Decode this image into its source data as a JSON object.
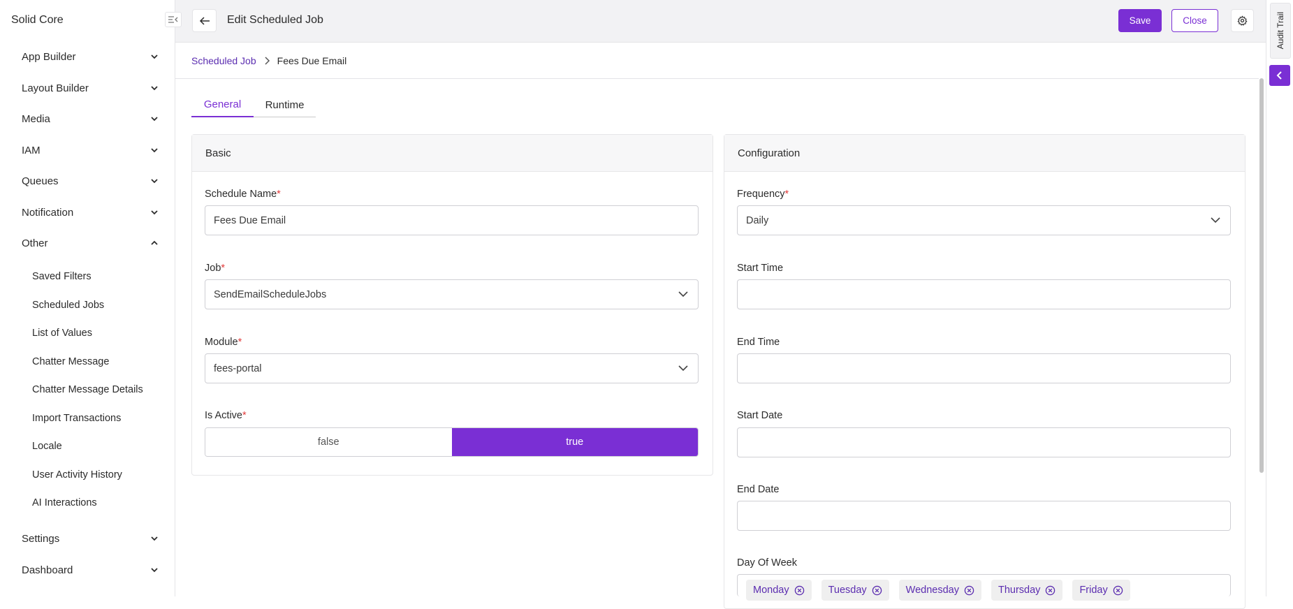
{
  "sidebar": {
    "brand": "Solid Core",
    "groups": [
      {
        "label": "App Builder",
        "expanded": false
      },
      {
        "label": "Layout Builder",
        "expanded": false
      },
      {
        "label": "Media",
        "expanded": false
      },
      {
        "label": "IAM",
        "expanded": false
      },
      {
        "label": "Queues",
        "expanded": false
      },
      {
        "label": "Notification",
        "expanded": false
      },
      {
        "label": "Other",
        "expanded": true
      },
      {
        "label": "Settings",
        "expanded": false
      },
      {
        "label": "Dashboard",
        "expanded": false
      }
    ],
    "other_items": [
      "Saved Filters",
      "Scheduled Jobs",
      "List of Values",
      "Chatter Message",
      "Chatter Message Details",
      "Import Transactions",
      "Locale",
      "User Activity History",
      "AI Interactions"
    ]
  },
  "header": {
    "title": "Edit Scheduled Job",
    "save_label": "Save",
    "close_label": "Close"
  },
  "right_rail": {
    "audit_label": "Audit Trail"
  },
  "breadcrumb": {
    "parent": "Scheduled Job",
    "current": "Fees Due Email"
  },
  "tabs": [
    {
      "label": "General",
      "active": true
    },
    {
      "label": "Runtime",
      "active": false
    }
  ],
  "basic": {
    "title": "Basic",
    "schedule_name": {
      "label": "Schedule Name",
      "value": "Fees Due Email"
    },
    "job": {
      "label": "Job",
      "value": "SendEmailScheduleJobs"
    },
    "module": {
      "label": "Module",
      "value": "fees-portal"
    },
    "is_active": {
      "label": "Is Active",
      "options": [
        "false",
        "true"
      ],
      "selected": "true"
    }
  },
  "configuration": {
    "title": "Configuration",
    "frequency": {
      "label": "Frequency",
      "value": "Daily"
    },
    "start_time": {
      "label": "Start Time",
      "value": ""
    },
    "end_time": {
      "label": "End Time",
      "value": ""
    },
    "start_date": {
      "label": "Start Date",
      "value": ""
    },
    "end_date": {
      "label": "End Date",
      "value": ""
    },
    "day_of_week": {
      "label": "Day Of Week",
      "values": [
        "Monday",
        "Tuesday",
        "Wednesday",
        "Thursday",
        "Friday"
      ]
    }
  },
  "colors": {
    "accent": "#7a2fd4",
    "required": "#e23b3b"
  },
  "required_mark": "*"
}
